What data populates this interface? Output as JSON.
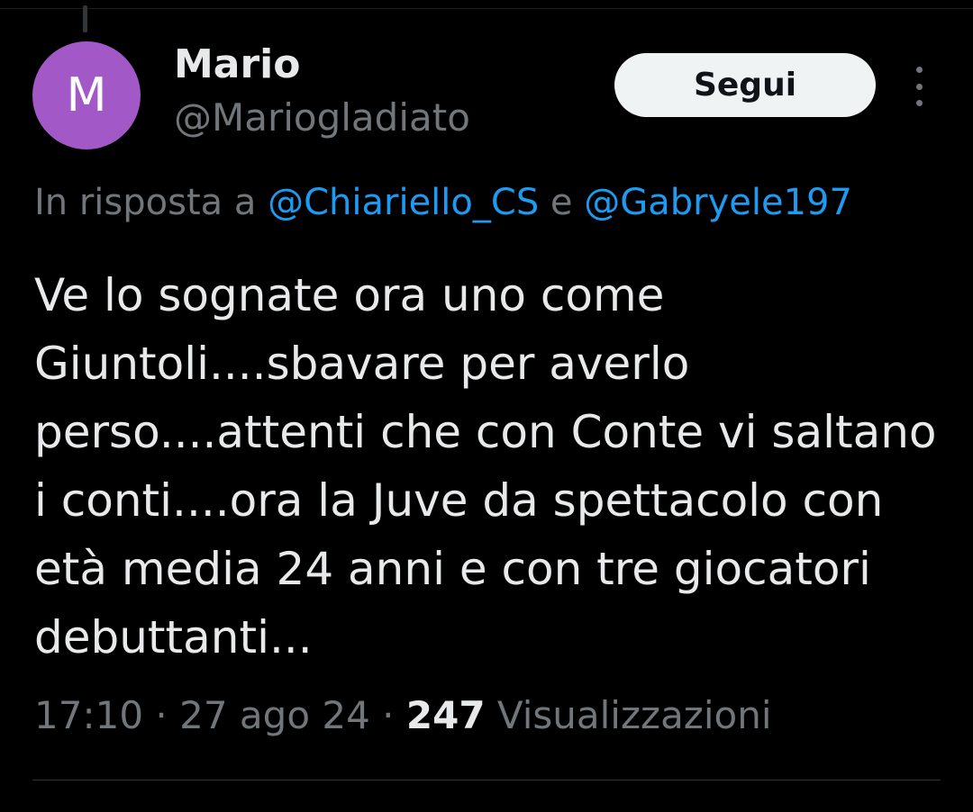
{
  "author": {
    "avatar_letter": "M",
    "avatar_color": "#a258c6",
    "display_name": "Mario",
    "handle": "@Mariogladiato"
  },
  "actions": {
    "follow_label": "Segui",
    "more_icon": "more-vertical-icon"
  },
  "reply_context": {
    "prefix": "In risposta a",
    "mention_1": "@Chiariello_CS",
    "conjunction": "e",
    "mention_2": "@Gabryele197"
  },
  "tweet": {
    "text": "Ve lo sognate ora uno come Giuntoli....sbavare per averlo perso....attenti che con Conte vi saltano i conti....ora la Juve da spettacolo con età media 24 anni e con tre giocatori debuttanti..."
  },
  "meta": {
    "time": "17:10",
    "date": "27 ago 24",
    "separator": "·",
    "views_count": "247",
    "views_label": "Visualizzazioni"
  },
  "colors": {
    "background": "#000000",
    "text": "#e7e9ea",
    "secondary": "#71767b",
    "link": "#1d9bf0",
    "button_bg": "#eff3f4"
  }
}
